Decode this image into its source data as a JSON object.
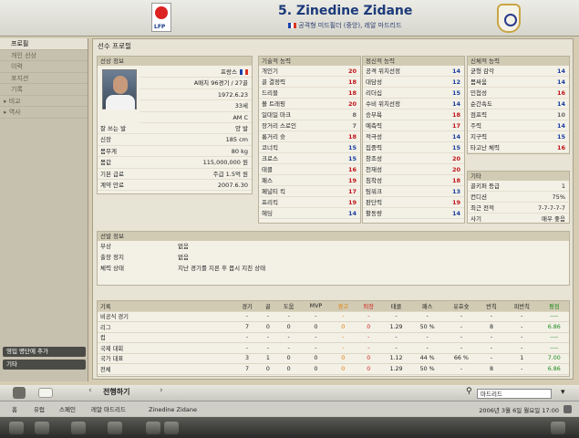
{
  "header": {
    "player_title": "5. Zinedine Zidane",
    "subtitle": "공격형 미드필더 (중앙), 레알 마드리드",
    "league_logo_text": "LFP"
  },
  "sidebar": {
    "items": [
      {
        "label": "프로필",
        "active": true
      },
      {
        "label": "개인 선상",
        "active": false
      },
      {
        "label": "이력",
        "active": false
      },
      {
        "label": "포지션",
        "active": false
      },
      {
        "label": "기록",
        "active": false
      },
      {
        "label": "▸ 비교",
        "active": false
      },
      {
        "label": "▸ 역사",
        "active": false
      }
    ],
    "bottom1": "영입 명단에 추가",
    "bottom2": "기타"
  },
  "panel_title": "선수 프로필",
  "info": {
    "title": "선상 정보",
    "rows": [
      {
        "value": "프랑스"
      },
      {
        "value": "A매치 96경기 / 27골"
      },
      {
        "value": "1972.6.23"
      },
      {
        "value": "33세"
      },
      {
        "value": "AM C"
      },
      {
        "label": "잘 쓰는 발",
        "value": "양 발"
      },
      {
        "label": "신장",
        "value": "185 cm"
      },
      {
        "label": "몸무게",
        "value": "80 kg"
      },
      {
        "label": "몸값",
        "value": "115,000,000 원"
      },
      {
        "label": "기본 급료",
        "value": "주급 1.5억 원"
      },
      {
        "label": "계약 만료",
        "value": "2007.6.30"
      }
    ]
  },
  "technical": {
    "title": "기술적 능력",
    "rows": [
      {
        "label": "개인기",
        "value": "20",
        "c": "r"
      },
      {
        "label": "골 결정력",
        "value": "18",
        "c": "r"
      },
      {
        "label": "드리블",
        "value": "18",
        "c": "r"
      },
      {
        "label": "볼 트래핑",
        "value": "20",
        "c": "r"
      },
      {
        "label": "일대일 마크",
        "value": "8",
        "c": "g"
      },
      {
        "label": "장거리 스로인",
        "value": "7",
        "c": "g"
      },
      {
        "label": "롱거리 슛",
        "value": "18",
        "c": "r"
      },
      {
        "label": "코너킥",
        "value": "15",
        "c": "b"
      },
      {
        "label": "크로스",
        "value": "15",
        "c": "b"
      },
      {
        "label": "태클",
        "value": "16",
        "c": "r"
      },
      {
        "label": "패스",
        "value": "19",
        "c": "r"
      },
      {
        "label": "페널티 킥",
        "value": "17",
        "c": "r"
      },
      {
        "label": "프리킥",
        "value": "19",
        "c": "r"
      },
      {
        "label": "헤딩",
        "value": "14",
        "c": "b"
      }
    ]
  },
  "mental": {
    "title": "정신적 능력",
    "rows": [
      {
        "label": "공격 위치선정",
        "value": "14",
        "c": "b"
      },
      {
        "label": "대담성",
        "value": "12",
        "c": "b"
      },
      {
        "label": "리더십",
        "value": "15",
        "c": "b"
      },
      {
        "label": "수비 위치선정",
        "value": "14",
        "c": "b"
      },
      {
        "label": "승부욕",
        "value": "18",
        "c": "r"
      },
      {
        "label": "예측력",
        "value": "17",
        "c": "r"
      },
      {
        "label": "적극성",
        "value": "14",
        "c": "b"
      },
      {
        "label": "집중력",
        "value": "15",
        "c": "b"
      },
      {
        "label": "창조성",
        "value": "20",
        "c": "r"
      },
      {
        "label": "천재성",
        "value": "20",
        "c": "r"
      },
      {
        "label": "침착성",
        "value": "18",
        "c": "r"
      },
      {
        "label": "팀워크",
        "value": "13",
        "c": "b"
      },
      {
        "label": "판단력",
        "value": "19",
        "c": "r"
      },
      {
        "label": "활동량",
        "value": "14",
        "c": "b"
      }
    ]
  },
  "physical": {
    "title": "신체적 능력",
    "rows": [
      {
        "label": "균형 감각",
        "value": "14",
        "c": "b"
      },
      {
        "label": "몸싸움",
        "value": "14",
        "c": "b"
      },
      {
        "label": "민첩성",
        "value": "16",
        "c": "r"
      },
      {
        "label": "순간속도",
        "value": "14",
        "c": "b"
      },
      {
        "label": "점프력",
        "value": "10",
        "c": "g"
      },
      {
        "label": "주력",
        "value": "14",
        "c": "b"
      },
      {
        "label": "지구력",
        "value": "15",
        "c": "b"
      },
      {
        "label": "타고난 체력",
        "value": "16",
        "c": "r"
      }
    ]
  },
  "etc": {
    "title": "기타",
    "rows": [
      {
        "label": "골키퍼 등급",
        "value": "1"
      },
      {
        "label": "컨디션",
        "value": "75%"
      },
      {
        "label": "최근 전적",
        "value": "7-7-7-7-7"
      },
      {
        "label": "사기",
        "value": "매우 좋음"
      }
    ]
  },
  "selection": {
    "title": "선발 정보",
    "rows": [
      {
        "label": "부상",
        "value": "없음"
      },
      {
        "label": "출장 정지",
        "value": "없음"
      },
      {
        "label": "체력 상태",
        "value": "지난 경기를 지른 후 몹시 지친 상태"
      }
    ]
  },
  "stats": {
    "headers": [
      "기록",
      "경기",
      "골",
      "도움",
      "MVP",
      "경고",
      "퇴장",
      "태클",
      "패스",
      "유효슛",
      "반칙",
      "피반칙",
      "평점"
    ],
    "rows": [
      [
        "비공식 경기",
        "-",
        "-",
        "-",
        "-",
        "-",
        "-",
        "-",
        "-",
        "-",
        "-",
        "-",
        "----"
      ],
      [
        "리그",
        "7",
        "0",
        "0",
        "0",
        "0",
        "0",
        "1.29",
        "50 %",
        "-",
        "8",
        "-",
        "6.86"
      ],
      [
        "컵",
        "-",
        "-",
        "-",
        "-",
        "-",
        "-",
        "-",
        "-",
        "-",
        "-",
        "-",
        "----"
      ],
      [
        "국제 대회",
        "-",
        "-",
        "-",
        "-",
        "-",
        "-",
        "-",
        "-",
        "-",
        "-",
        "-",
        "----"
      ],
      [
        "국가 대표",
        "3",
        "1",
        "0",
        "0",
        "0",
        "0",
        "1.12",
        "44 %",
        "66 %",
        "-",
        "1",
        "7.00"
      ],
      [
        "전체",
        "7",
        "0",
        "0",
        "0",
        "0",
        "0",
        "1.29",
        "50 %",
        "-",
        "8",
        "-",
        "6.86"
      ]
    ]
  },
  "nav": {
    "progress_label": "전행하기",
    "search_value": "마드리드",
    "crumbs": [
      "홈",
      "유럽",
      "스페인",
      "레알 마드리드",
      "Zinedine Zidane"
    ],
    "date": "2006년 3월 6일 월요일 17:00"
  },
  "colors": {
    "rating_high": "#c0141a",
    "rating_mid": "#1a3fa0",
    "rating_low": "#666666"
  }
}
